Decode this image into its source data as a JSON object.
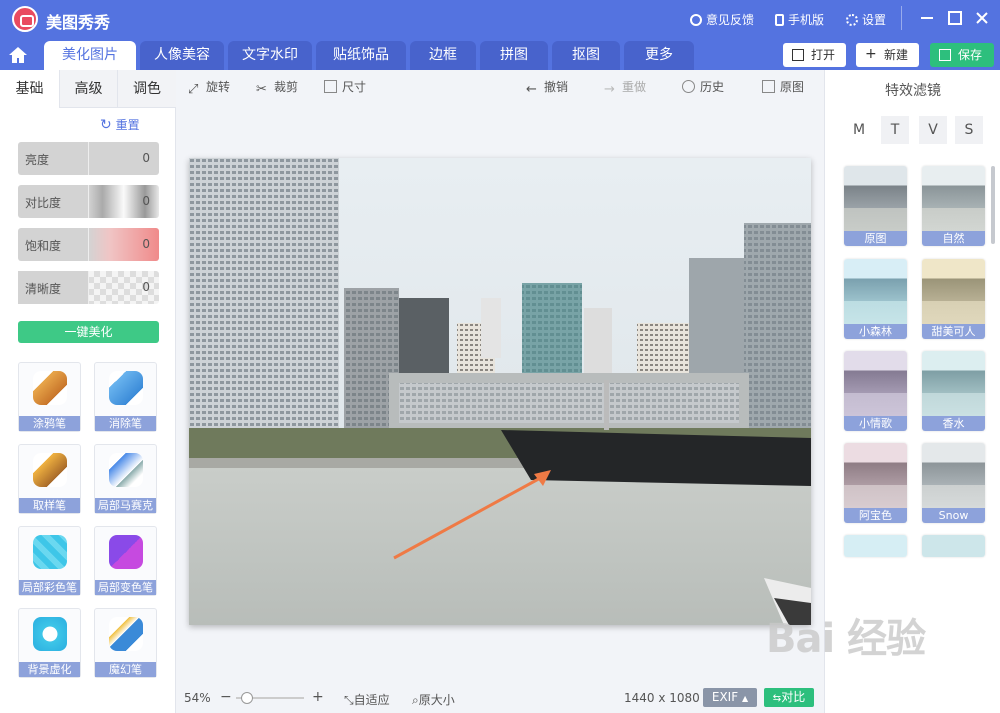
{
  "app": {
    "name": "美图秀秀"
  },
  "titlebar": {
    "feedback": "意见反馈",
    "mobile": "手机版",
    "settings": "设置"
  },
  "tabs": [
    {
      "label": "美化图片",
      "active": true
    },
    {
      "label": "人像美容"
    },
    {
      "label": "文字水印"
    },
    {
      "label": "贴纸饰品"
    },
    {
      "label": "边框"
    },
    {
      "label": "拼图"
    },
    {
      "label": "抠图"
    },
    {
      "label": "更多"
    }
  ],
  "actions": {
    "open": "打开",
    "new": "新建",
    "save": "保存"
  },
  "left": {
    "subtabs": [
      "基础",
      "高级",
      "调色"
    ],
    "reset": "重置",
    "sliders": [
      {
        "label": "亮度",
        "value": "0"
      },
      {
        "label": "对比度",
        "value": "0"
      },
      {
        "label": "饱和度",
        "value": "0"
      },
      {
        "label": "清晰度",
        "value": "0"
      }
    ],
    "onekey": "一键美化",
    "tools": [
      "涂鸦笔",
      "消除笔",
      "取样笔",
      "局部马赛克",
      "局部彩色笔",
      "局部变色笔",
      "背景虚化",
      "魔幻笔"
    ]
  },
  "toolbar": {
    "rotate": "旋转",
    "crop": "裁剪",
    "size": "尺寸",
    "undo": "撤销",
    "redo": "重做",
    "history": "历史",
    "original": "原图"
  },
  "status": {
    "zoom": "54%",
    "minus": "−",
    "plus": "+",
    "fit": "自适应",
    "actual": "原大小",
    "dimensions": "1440 x 1080",
    "exif": "EXIF",
    "compare": "对比"
  },
  "right": {
    "title": "特效滤镜",
    "letters": [
      "M",
      "T",
      "V",
      "S"
    ],
    "filters": [
      "原图",
      "自然",
      "小森林",
      "甜美可人",
      "小情歌",
      "香水",
      "阿宝色",
      "Snow"
    ]
  },
  "colors": {
    "primary": "#5473e0",
    "green": "#2dbf7d",
    "label_bg": "#8da2db"
  }
}
